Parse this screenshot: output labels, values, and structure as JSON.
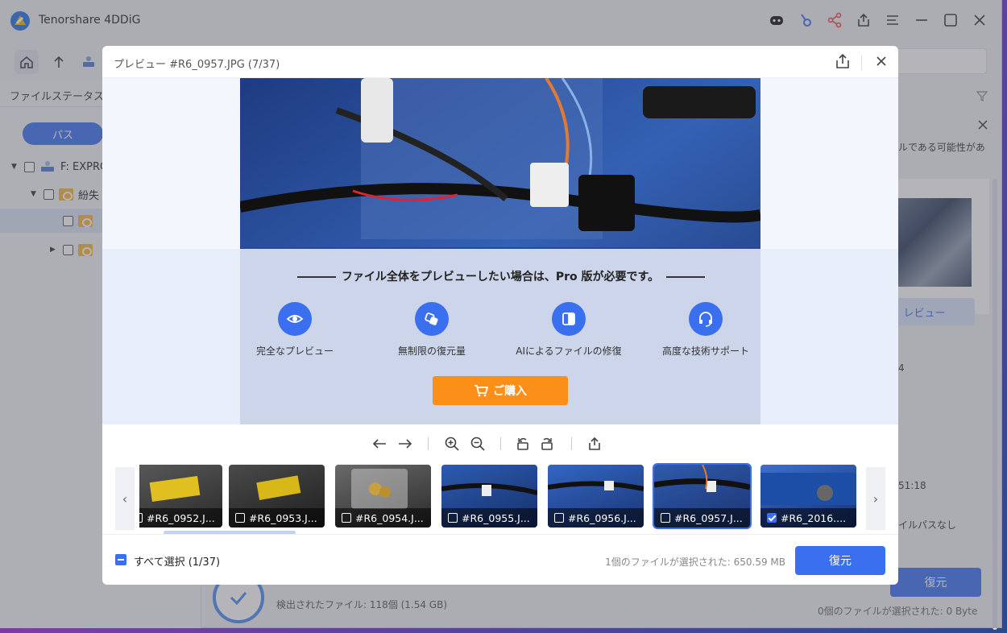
{
  "app": {
    "title": "Tenorshare 4DDiG"
  },
  "left_panel": {
    "file_status_label": "ファイルステータス",
    "path_button": "パス",
    "tree": [
      {
        "label": "F: EXPRO"
      },
      {
        "label": "紛失"
      },
      {
        "label": ""
      },
      {
        "label": ""
      }
    ]
  },
  "right_panel": {
    "text_1": "ルである可能性があ",
    "preview_button": "レビュー",
    "text_2": "4",
    "time_fragment": "51:18",
    "path_fragment": "イルパスなし",
    "restore_button": "復元",
    "selected_info": "0個のファイルが選択された:  0 Byte"
  },
  "scan": {
    "found_files": "検出されたファイル: 118個 (1.54 GB)"
  },
  "modal": {
    "title": "プレビュー #R6_0957.JPG (7/37)",
    "upsell_title": "ファイル全体をプレビューしたい場合は、Pro 版が必要です。",
    "features": [
      {
        "label": "完全なプレビュー",
        "icon": "eye-icon"
      },
      {
        "label": "無制限の復元量",
        "icon": "unlimited-icon"
      },
      {
        "label": "AIによるファイルの修復",
        "icon": "ai-repair-icon"
      },
      {
        "label": "高度な技術サポート",
        "icon": "headset-icon"
      }
    ],
    "buy_button": "ご購入",
    "thumbnails": [
      {
        "label": "#R6_0952.J...",
        "checked": false
      },
      {
        "label": "#R6_0953.J...",
        "checked": false
      },
      {
        "label": "#R6_0954.J...",
        "checked": false
      },
      {
        "label": "#R6_0955.J...",
        "checked": false
      },
      {
        "label": "#R6_0956.J...",
        "checked": false
      },
      {
        "label": "#R6_0957.J...",
        "checked": false
      },
      {
        "label": "#R6_2016....",
        "checked": true
      }
    ],
    "select_all": "すべて選択 (1/37)",
    "selected_info": "1個のファイルが選択された:  650.59 MB",
    "restore_button": "復元"
  },
  "colors": {
    "accent": "#3a6ff0",
    "buy": "#fb8f17"
  }
}
